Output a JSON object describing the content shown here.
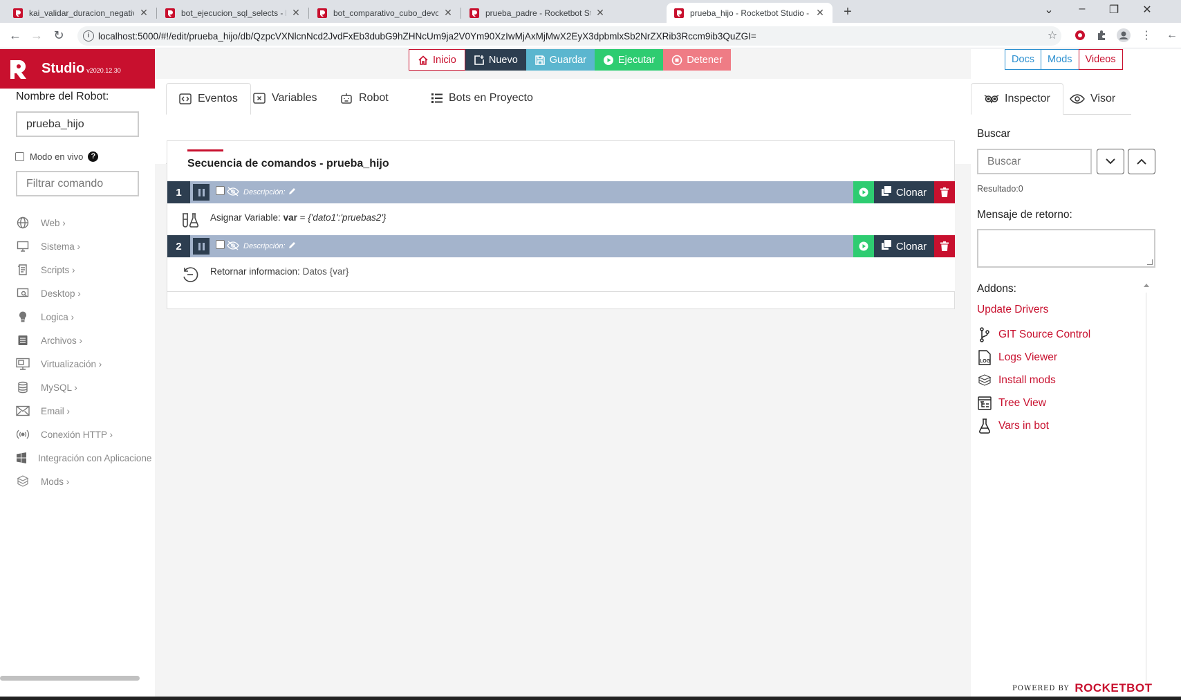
{
  "browser": {
    "tabs": [
      {
        "title": "kai_validar_duracion_negativa - R",
        "active": false
      },
      {
        "title": "bot_ejecucion_sql_selects - Rocke",
        "active": false
      },
      {
        "title": "bot_comparativo_cubo_devolucio",
        "active": false
      },
      {
        "title": "prueba_padre - Rocketbot Studio",
        "active": false
      },
      {
        "title": "prueba_hijo - Rocketbot Studio -",
        "active": true
      }
    ],
    "url": "localhost:5000/#!/edit/prueba_hijo/db/QzpcVXNlcnNcd2JvdFxEb3dubG9hZHNcUm9ja2V0Ym90XzIwMjAxMjMwX2EyX3dpbmlxSb2NrZXRib3Rccm9ib3QuZGI="
  },
  "brand": {
    "name": "Studio",
    "version": "v2020.12.30",
    "accent": "#c8102e"
  },
  "sidebar": {
    "robot_name_label": "Nombre del Robot:",
    "robot_name_value": "prueba_hijo",
    "live_mode_label": "Modo en vivo",
    "filter_placeholder": "Filtrar comando",
    "categories": [
      {
        "label": "Web ›",
        "icon": "globe-icon"
      },
      {
        "label": "Sistema ›",
        "icon": "monitor-icon"
      },
      {
        "label": "Scripts ›",
        "icon": "script-icon"
      },
      {
        "label": "Desktop ›",
        "icon": "desktop-search-icon"
      },
      {
        "label": "Logica ›",
        "icon": "lightbulb-icon"
      },
      {
        "label": "Archivos ›",
        "icon": "archive-icon"
      },
      {
        "label": "Virtualización ›",
        "icon": "virtual-machine-icon"
      },
      {
        "label": "MySQL ›",
        "icon": "database-icon"
      },
      {
        "label": "Email ›",
        "icon": "envelope-icon"
      },
      {
        "label": "Conexión HTTP ›",
        "icon": "broadcast-icon"
      },
      {
        "label": "Integración con Aplicacione",
        "icon": "windows-icon"
      },
      {
        "label": "Mods ›",
        "icon": "boxes-icon"
      }
    ]
  },
  "toolbar": {
    "inicio": "Inicio",
    "nuevo": "Nuevo",
    "guardar": "Guardar",
    "ejecutar": "Ejecutar",
    "detener": "Detener"
  },
  "tabs": {
    "eventos": "Eventos",
    "variables": "Variables",
    "robot": "Robot",
    "bots": "Bots en Proyecto"
  },
  "sequence": {
    "title": "Secuencia de comandos",
    "bot": "prueba_hijo",
    "commands": [
      {
        "number": "1",
        "description": "Descripción:",
        "clone": "Clonar",
        "icon": "flask-variable-icon",
        "action": "Asignar Variable:",
        "var": "var",
        "eq": "=",
        "value": "{'dato1':'pruebas2'}"
      },
      {
        "number": "2",
        "description": "Descripción:",
        "clone": "Clonar",
        "icon": "return-icon",
        "action": "Retornar informacion:",
        "var": "Datos",
        "value": "{var}"
      }
    ]
  },
  "right": {
    "docs": "Docs",
    "mods": "Mods",
    "videos": "Videos",
    "inspector": "Inspector",
    "visor": "Visor",
    "search_label": "Buscar",
    "search_placeholder": "Buscar",
    "result": "Resultado:0",
    "return_label": "Mensaje de retorno:",
    "addons_label": "Addons:",
    "update_drivers": "Update Drivers",
    "addons": [
      {
        "label": "GIT Source Control",
        "icon": "git-branch-icon"
      },
      {
        "label": "Logs Viewer",
        "icon": "log-file-icon"
      },
      {
        "label": "Install mods",
        "icon": "install-mods-icon"
      },
      {
        "label": "Tree View",
        "icon": "tree-view-icon"
      },
      {
        "label": "Vars in bot",
        "icon": "flask-icon"
      }
    ]
  },
  "footer": {
    "powered_by": "POWERED BY",
    "brand": "ROCKETBOT"
  }
}
